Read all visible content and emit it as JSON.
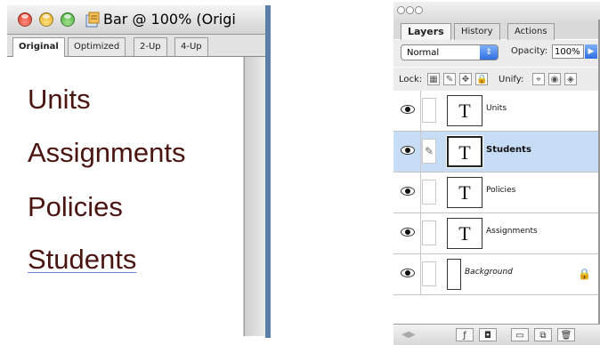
{
  "document_window": {
    "title": "Bar @ 100% (Origi",
    "tabs": [
      "Original",
      "Optimized",
      "2-Up",
      "4-Up"
    ],
    "active_tab": "Original",
    "canvas_words": [
      "Units",
      "Assignments",
      "Policies",
      "Students"
    ],
    "text_color": "#4a1411"
  },
  "layers_palette": {
    "tabs": [
      "Layers",
      "History",
      "Actions"
    ],
    "active_tab": "Layers",
    "blend_mode": "Normal",
    "opacity_label": "Opacity:",
    "opacity_value": "100%",
    "lock_label": "Lock:",
    "unify_label": "Unify:",
    "layers": [
      {
        "name": "Units",
        "thumb": "T",
        "visible": true,
        "selected": false
      },
      {
        "name": "Students",
        "thumb": "T",
        "visible": true,
        "selected": true
      },
      {
        "name": "Policies",
        "thumb": "T",
        "visible": true,
        "selected": false
      },
      {
        "name": "Assignments",
        "thumb": "T",
        "visible": true,
        "selected": false
      },
      {
        "name": "Background",
        "thumb": "",
        "visible": true,
        "selected": false,
        "locked": true
      }
    ],
    "selected_color": "#c7ddf5"
  }
}
